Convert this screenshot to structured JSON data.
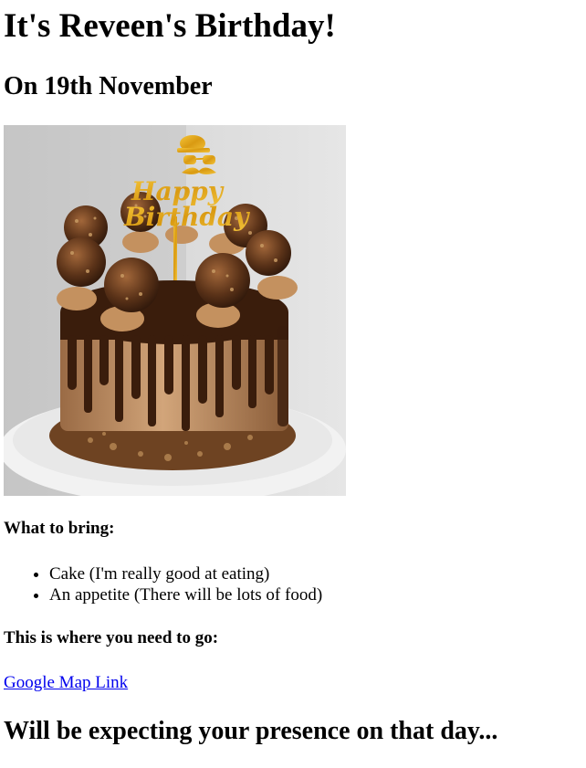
{
  "heading": "It's Reveen's Birthday!",
  "subheading": "On 19th November",
  "image": {
    "topper_text_line1": "Happy",
    "topper_text_line2": "Birthday",
    "topper_color": "#e0a81c"
  },
  "bring": {
    "title": "What to bring:",
    "items": [
      "Cake (I'm really good at eating)",
      "An appetite (There will be lots of food)"
    ]
  },
  "where": {
    "title": "This is where you need to go:",
    "link_text": "Google Map Link"
  },
  "closing": "Will be expecting your presence on that day...",
  "colors": {
    "link": "#0000ee",
    "text": "#000000"
  }
}
